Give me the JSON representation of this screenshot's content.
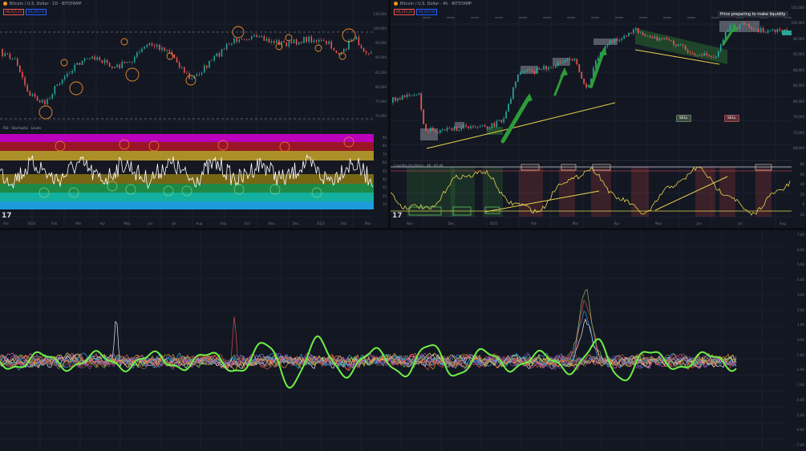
{
  "left_chart": {
    "header": "Bitcoin / U.S. Dollar · 1D · BITSTAMP",
    "sell_price": "96,415.25",
    "buy_price": "96,430.00",
    "indicator_title": "RSI · Stochastic · Levels",
    "price_axis": [
      "110,000",
      "100,000",
      "95,000",
      "90,000",
      "85,000",
      "80,000",
      "75,000",
      "70,000"
    ],
    "osc_axis": [
      "90",
      "80",
      "70",
      "60",
      "50",
      "40",
      "30",
      "20",
      "10"
    ],
    "time_axis": [
      "Oct",
      "2024",
      "Feb",
      "Mar",
      "Apr",
      "May",
      "Jun",
      "Jul",
      "Aug",
      "Sep",
      "Oct",
      "Nov",
      "Dec",
      "2025",
      "Feb",
      "Mar"
    ],
    "logo": "17",
    "band_colors": [
      "#c400c4",
      "#a01628",
      "#b3962a",
      "#151822",
      "#7c6b15",
      "#1e8f4a",
      "#14b8a6",
      "#1ca3e6"
    ]
  },
  "right_chart": {
    "header": "Bitcoin / U.S. Dollar · 4h · BITSTAMP",
    "sell_price": "96,415.25",
    "buy_price": "96,430.00",
    "indicator_title": "Liquidity Oscillator · 48 · 60.49",
    "note": "Price preparing to make liquidity",
    "sell_tag": "SELL",
    "buy_tag": "SELL",
    "price_axis": [
      "105,000",
      "100,000",
      "96,000",
      "92,000",
      "88,000",
      "84,000",
      "80,000",
      "76,000",
      "72,000",
      "68,000"
    ],
    "osc_axis": [
      "80",
      "60",
      "40",
      "20",
      "0",
      "-20"
    ],
    "time_axis": [
      "Nov",
      "Dec",
      "2025",
      "Feb",
      "Mar",
      "Apr",
      "May",
      "Jun",
      "Jul",
      "Aug"
    ],
    "logo": "17"
  },
  "bottom_chart": {
    "y_axis": [
      "7.00",
      "6.00",
      "5.00",
      "4.00",
      "3.00",
      "2.00",
      "1.00",
      "0.00",
      "-1.00",
      "-2.00",
      "-3.00",
      "-4.00",
      "-5.00",
      "-6.00",
      "-7.00"
    ]
  }
}
